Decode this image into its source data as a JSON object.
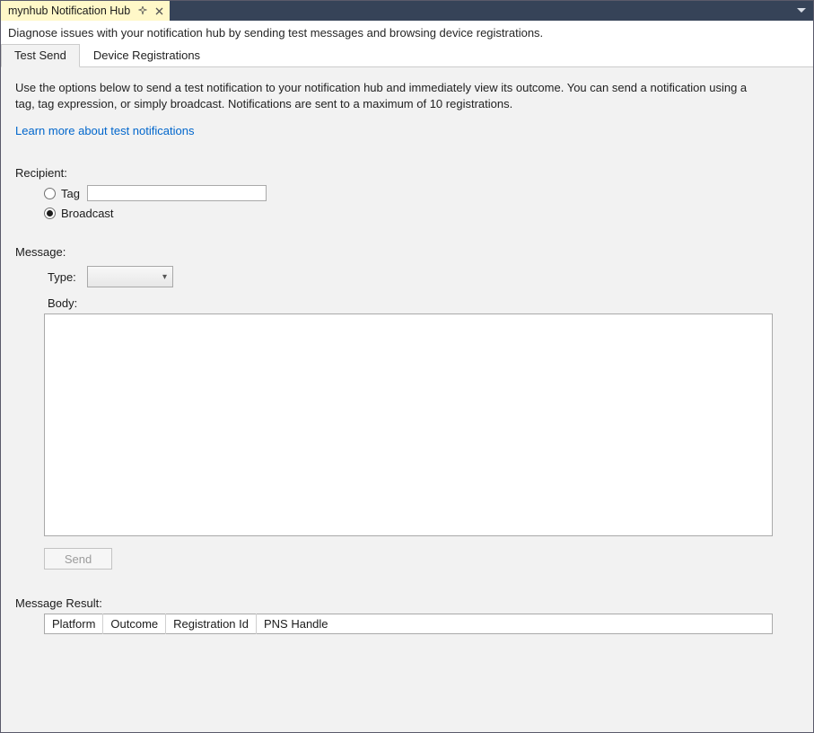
{
  "tab": {
    "title": "mynhub Notification Hub"
  },
  "description": "Diagnose issues with your notification hub by sending test messages and browsing device registrations.",
  "navTabs": {
    "testSend": "Test Send",
    "deviceRegistrations": "Device Registrations",
    "active": "testSend"
  },
  "panel": {
    "intro": "Use the options below to send a test notification to your notification hub and immediately view its outcome. You can send a notification using a tag, tag expression, or simply broadcast. Notifications are sent to a maximum of 10 registrations.",
    "learnMore": "Learn more about test notifications",
    "recipient": {
      "label": "Recipient:",
      "tagLabel": "Tag",
      "tagValue": "",
      "broadcastLabel": "Broadcast",
      "selected": "broadcast"
    },
    "message": {
      "label": "Message:",
      "typeLabel": "Type:",
      "typeValue": "",
      "bodyLabel": "Body:",
      "bodyValue": "",
      "sendLabel": "Send"
    },
    "result": {
      "label": "Message Result:",
      "columns": {
        "platform": "Platform",
        "outcome": "Outcome",
        "registrationId": "Registration Id",
        "pnsHandle": "PNS Handle"
      },
      "rows": []
    }
  }
}
